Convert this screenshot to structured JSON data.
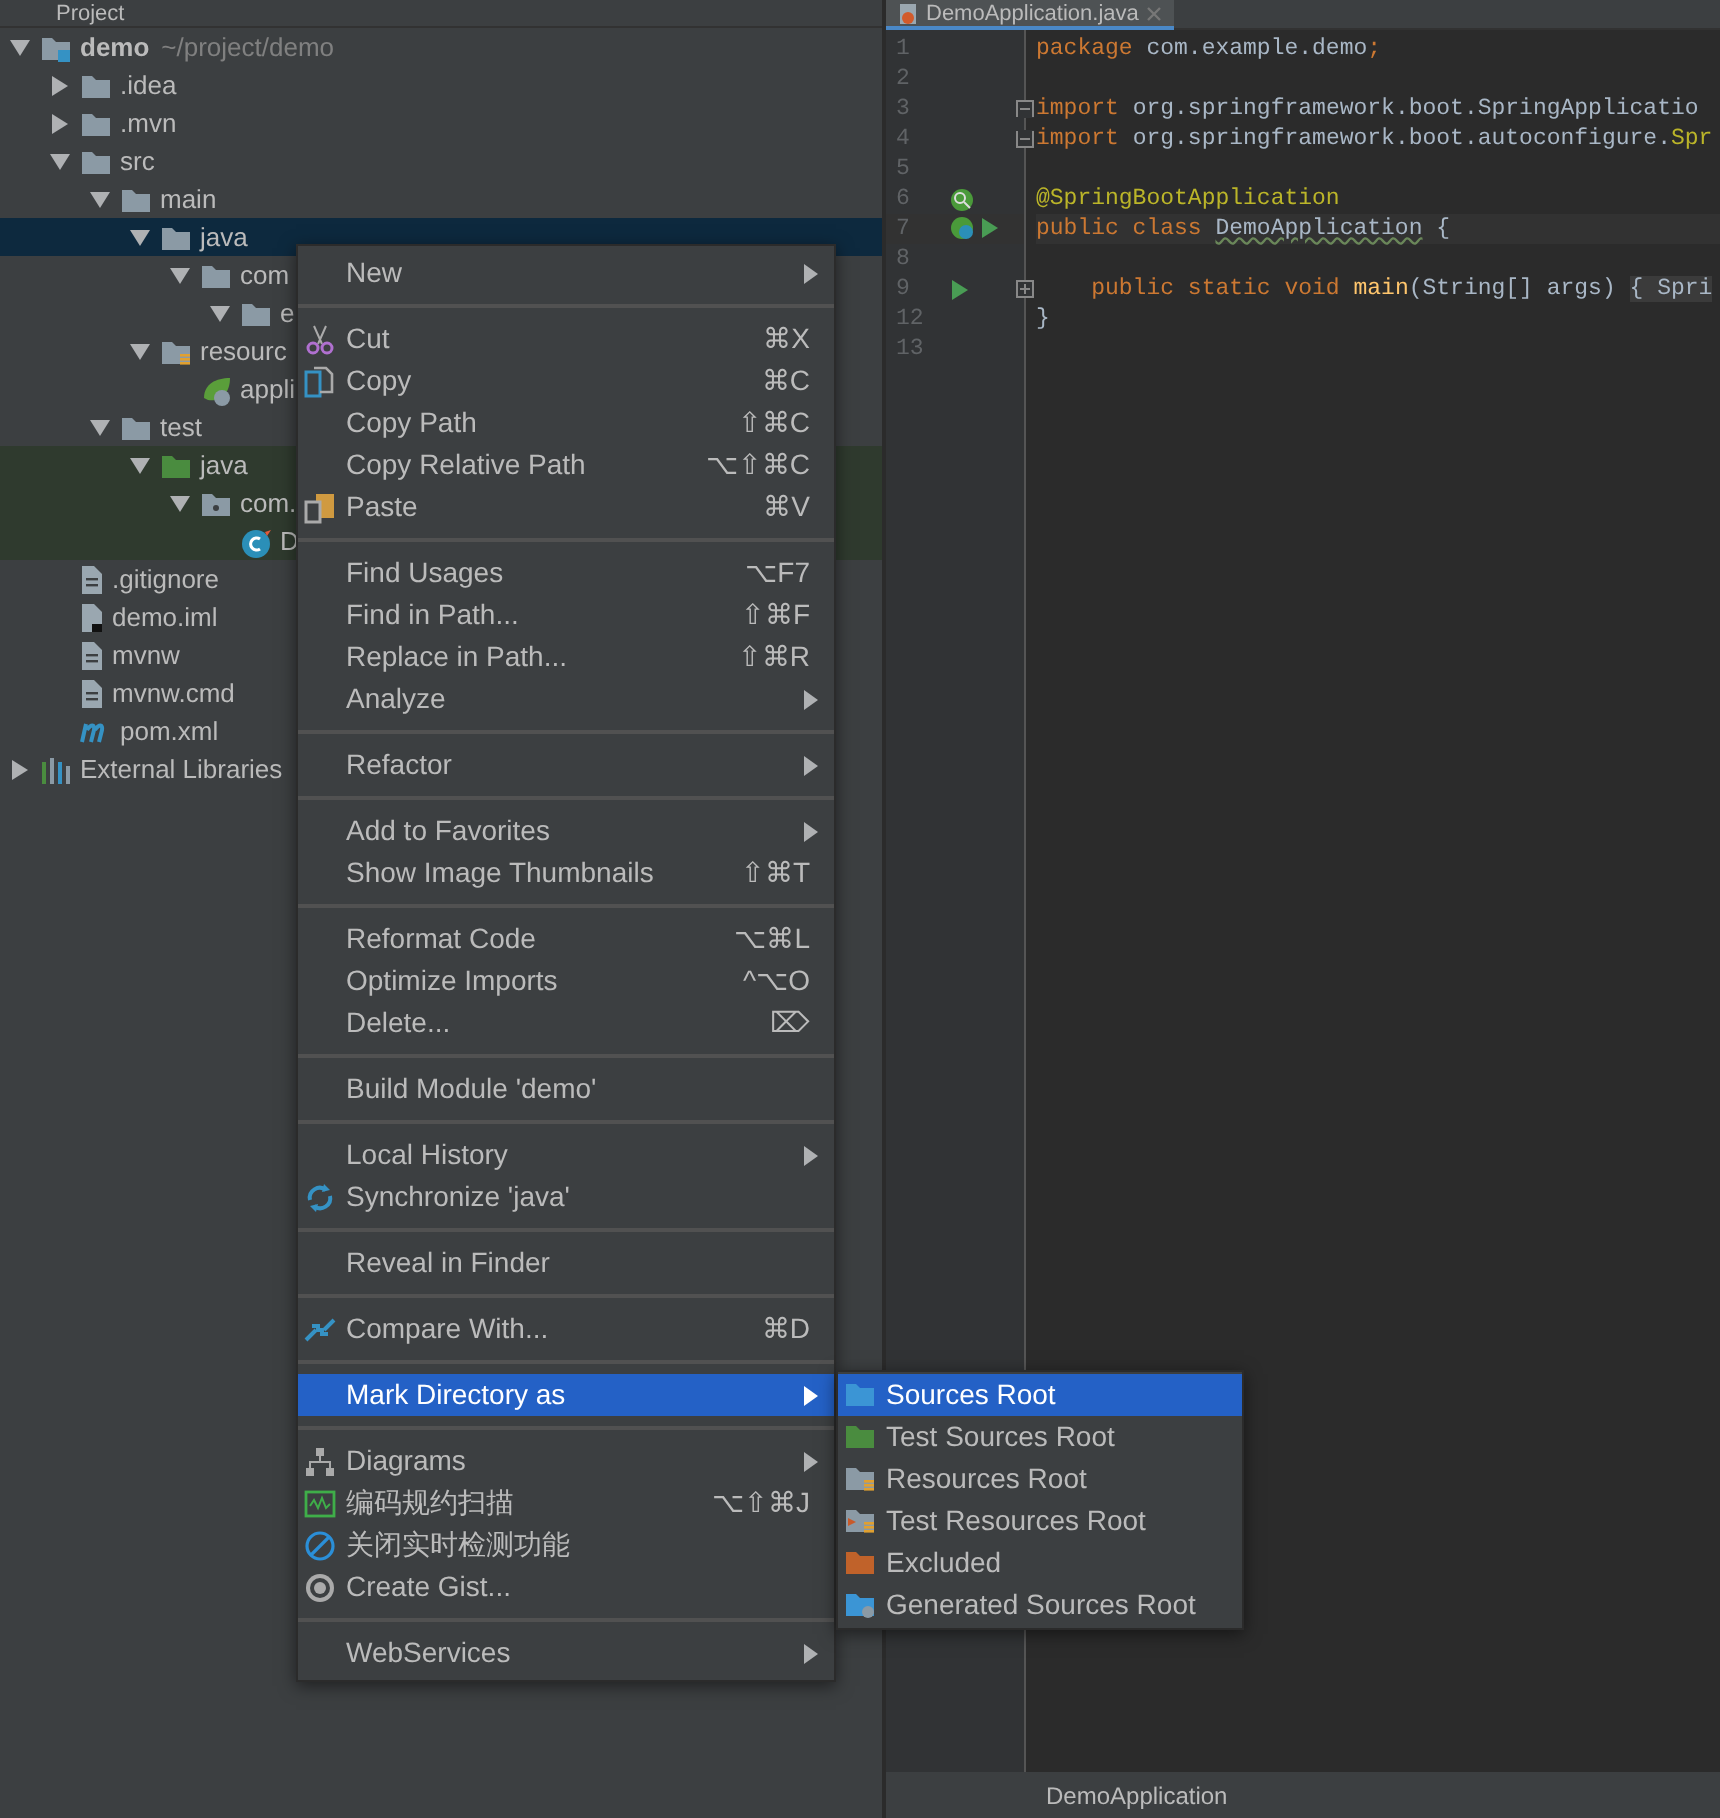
{
  "project_panel": {
    "title": "Project",
    "tree": [
      {
        "label": "demo",
        "hint": "~/project/demo",
        "kind": "module",
        "expanded": true,
        "selected": false,
        "children": [
          {
            "label": ".idea",
            "kind": "folder",
            "expanded": false,
            "selected": false
          },
          {
            "label": ".mvn",
            "kind": "folder",
            "expanded": false,
            "selected": false
          },
          {
            "label": "src",
            "kind": "folder",
            "expanded": true,
            "selected": false,
            "children": [
              {
                "label": "main",
                "kind": "folder",
                "expanded": true,
                "selected": false,
                "children": [
                  {
                    "label": "java",
                    "kind": "folder",
                    "expanded": true,
                    "selected": true,
                    "children": [
                      {
                        "label": "com",
                        "kind": "folder",
                        "expanded": true,
                        "selected": false,
                        "children": [
                          {
                            "label": "e",
                            "kind": "folder",
                            "expanded": true,
                            "selected": false
                          }
                        ]
                      }
                    ]
                  },
                  {
                    "label": "resourc",
                    "kind": "resources",
                    "expanded": true,
                    "selected": false,
                    "children": [
                      {
                        "label": "appli",
                        "kind": "spring-config",
                        "selected": false
                      }
                    ]
                  }
                ]
              },
              {
                "label": "test",
                "kind": "folder",
                "expanded": true,
                "selected": false,
                "children": [
                  {
                    "label": "java",
                    "kind": "test-folder",
                    "expanded": true,
                    "test_scope": true,
                    "selected": false,
                    "children": [
                      {
                        "label": "com.",
                        "kind": "package",
                        "expanded": true,
                        "test_scope": true,
                        "selected": false,
                        "children": [
                          {
                            "label": "D",
                            "kind": "java-class",
                            "test_scope": true,
                            "selected": false
                          }
                        ]
                      }
                    ]
                  }
                ]
              }
            ]
          },
          {
            "label": ".gitignore",
            "kind": "file",
            "selected": false
          },
          {
            "label": "demo.iml",
            "kind": "iml-file",
            "selected": false
          },
          {
            "label": "mvnw",
            "kind": "file",
            "selected": false
          },
          {
            "label": "mvnw.cmd",
            "kind": "file",
            "selected": false
          },
          {
            "label": "pom.xml",
            "kind": "maven",
            "selected": false
          }
        ]
      },
      {
        "label": "External Libraries",
        "kind": "libraries",
        "expanded": false,
        "selected": false
      }
    ]
  },
  "editor": {
    "tab": {
      "label": "DemoApplication.java",
      "selected": true
    },
    "lines": [
      {
        "number": "1",
        "tokens": [
          {
            "kind": "keyword",
            "text": "package"
          },
          {
            "kind": "plain",
            "text": " com.example.demo"
          },
          {
            "kind": "keyword",
            "text": ";"
          }
        ]
      },
      {
        "number": "2"
      },
      {
        "number": "3",
        "markers": [
          {
            "kind": "fold-start"
          }
        ],
        "tokens": [
          {
            "kind": "keyword",
            "text": "import"
          },
          {
            "kind": "plain",
            "text": " org.springframework.boot.SpringApplicatio"
          }
        ]
      },
      {
        "number": "4",
        "markers": [
          {
            "kind": "fold-end"
          }
        ],
        "tokens": [
          {
            "kind": "keyword",
            "text": "import"
          },
          {
            "kind": "plain",
            "text": " org.springframework.boot.autoconfigure."
          },
          {
            "kind": "annotation",
            "text": "Spr"
          }
        ]
      },
      {
        "number": "5"
      },
      {
        "number": "6",
        "markers": [
          {
            "kind": "bean-search"
          }
        ],
        "tokens": [
          {
            "kind": "annotation",
            "text": "@SpringBootApplication"
          }
        ]
      },
      {
        "number": "7",
        "current": true,
        "markers": [
          {
            "kind": "bean"
          },
          {
            "kind": "run"
          }
        ],
        "tokens": [
          {
            "kind": "keyword",
            "text": "public class "
          },
          {
            "kind": "warning",
            "text": "DemoApplication"
          },
          {
            "kind": "plain",
            "text": " {"
          }
        ]
      },
      {
        "number": "8"
      },
      {
        "number": "9",
        "markers": [
          {
            "kind": "run"
          },
          {
            "kind": "fold-collapsed"
          }
        ],
        "tokens": [
          {
            "kind": "keyword",
            "text": "    public static void "
          },
          {
            "kind": "method",
            "text": "main"
          },
          {
            "kind": "plain",
            "text": "(String[] args) "
          },
          {
            "kind": "folded",
            "text": "{ Spri"
          }
        ]
      },
      {
        "number": "12",
        "tokens": [
          {
            "kind": "plain",
            "text": "}"
          }
        ]
      },
      {
        "number": "13"
      }
    ],
    "status": "DemoApplication"
  },
  "context_menu": {
    "groups": [
      [
        {
          "label": "New",
          "submenu": true,
          "selected": false
        }
      ],
      [
        {
          "label": "Cut",
          "kind": "cut",
          "shortcut": "⌘X",
          "selected": false
        },
        {
          "label": "Copy",
          "kind": "copy",
          "shortcut": "⌘C",
          "selected": false
        },
        {
          "label": "Copy Path",
          "shortcut": "⇧⌘C",
          "selected": false
        },
        {
          "label": "Copy Relative Path",
          "shortcut": "⌥⇧⌘C",
          "selected": false
        },
        {
          "label": "Paste",
          "kind": "paste",
          "shortcut": "⌘V",
          "selected": false
        }
      ],
      [
        {
          "label": "Find Usages",
          "shortcut": "⌥F7",
          "selected": false
        },
        {
          "label": "Find in Path...",
          "shortcut": "⇧⌘F",
          "selected": false
        },
        {
          "label": "Replace in Path...",
          "shortcut": "⇧⌘R",
          "selected": false
        },
        {
          "label": "Analyze",
          "submenu": true,
          "selected": false
        }
      ],
      [
        {
          "label": "Refactor",
          "submenu": true,
          "selected": false
        }
      ],
      [
        {
          "label": "Add to Favorites",
          "submenu": true,
          "selected": false
        },
        {
          "label": "Show Image Thumbnails",
          "shortcut": "⇧⌘T",
          "selected": false
        }
      ],
      [
        {
          "label": "Reformat Code",
          "shortcut": "⌥⌘L",
          "selected": false
        },
        {
          "label": "Optimize Imports",
          "shortcut": "^⌥O",
          "selected": false
        },
        {
          "label": "Delete...",
          "shortcut": "⌦",
          "selected": false
        }
      ],
      [
        {
          "label": "Build Module 'demo'",
          "selected": false
        }
      ],
      [
        {
          "label": "Local History",
          "submenu": true,
          "selected": false
        },
        {
          "label": "Synchronize 'java'",
          "kind": "sync",
          "selected": false
        }
      ],
      [
        {
          "label": "Reveal in Finder",
          "selected": false
        }
      ],
      [
        {
          "label": "Compare With...",
          "kind": "compare",
          "shortcut": "⌘D",
          "selected": false
        }
      ],
      [
        {
          "label": "Mark Directory as",
          "submenu": true,
          "selected": true
        }
      ],
      [
        {
          "label": "Diagrams",
          "kind": "diagram",
          "submenu": true,
          "selected": false
        },
        {
          "label": "编码规约扫描",
          "kind": "scan",
          "shortcut": "⌥⇧⌘J",
          "selected": false
        },
        {
          "label": "关闭实时检测功能",
          "kind": "forbidden",
          "selected": false
        },
        {
          "label": "Create Gist...",
          "kind": "github",
          "selected": false
        }
      ],
      [
        {
          "label": "WebServices",
          "submenu": true,
          "selected": false
        }
      ]
    ],
    "submenu": [
      {
        "label": "Sources Root",
        "kind": "sources",
        "selected": true
      },
      {
        "label": "Test Sources Root",
        "kind": "test-sources",
        "selected": false
      },
      {
        "label": "Resources Root",
        "kind": "resources",
        "selected": false
      },
      {
        "label": "Test Resources Root",
        "kind": "test-resources",
        "selected": false
      },
      {
        "label": "Excluded",
        "kind": "excluded",
        "selected": false
      },
      {
        "label": "Generated Sources Root",
        "kind": "generated",
        "selected": false
      }
    ]
  }
}
